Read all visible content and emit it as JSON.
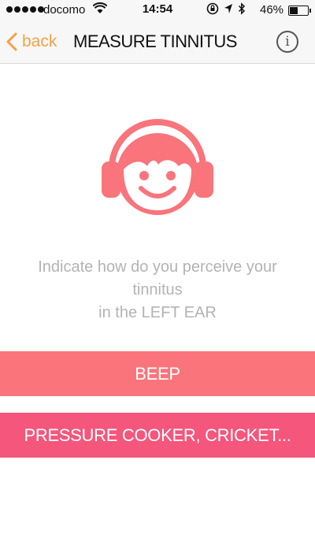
{
  "status_bar": {
    "carrier": "docomo",
    "time": "14:54",
    "battery": "46%",
    "battery_level": 0.46
  },
  "nav": {
    "back_label": "back",
    "title": "MEASURE TINNITUS",
    "info_label": "i"
  },
  "colors": {
    "accent": "#f5a145",
    "mascot": "#f9747b",
    "option_1": "#f9747b",
    "option_2": "#f4567c",
    "instruction_text": "#b3b3b3"
  },
  "instruction": {
    "line1": "Indicate how do you perceive your",
    "line2": "tinnitus",
    "line3": "in the LEFT EAR"
  },
  "options": [
    {
      "label": "BEEP"
    },
    {
      "label": "PRESSURE COOKER, CRICKET..."
    }
  ]
}
